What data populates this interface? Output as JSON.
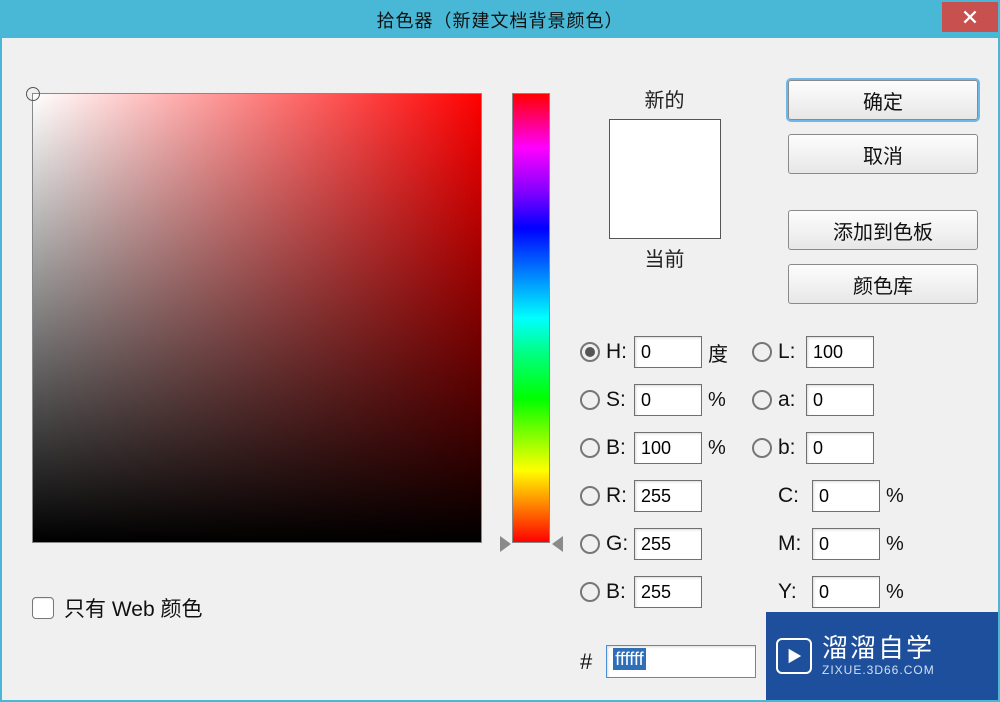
{
  "window": {
    "title": "拾色器（新建文档背景颜色）"
  },
  "swatch": {
    "new_label": "新的",
    "current_label": "当前"
  },
  "buttons": {
    "ok": "确定",
    "cancel": "取消",
    "add_swatch": "添加到色板",
    "color_lib": "颜色库"
  },
  "fields": {
    "h": {
      "label": "H:",
      "value": "0",
      "unit": "度"
    },
    "s": {
      "label": "S:",
      "value": "0",
      "unit": "%"
    },
    "b": {
      "label": "B:",
      "value": "100",
      "unit": "%"
    },
    "r": {
      "label": "R:",
      "value": "255"
    },
    "g": {
      "label": "G:",
      "value": "255"
    },
    "b2": {
      "label": "B:",
      "value": "255"
    },
    "l": {
      "label": "L:",
      "value": "100"
    },
    "a": {
      "label": "a:",
      "value": "0"
    },
    "lb": {
      "label": "b:",
      "value": "0"
    },
    "c": {
      "label": "C:",
      "value": "0",
      "unit": "%"
    },
    "m": {
      "label": "M:",
      "value": "0",
      "unit": "%"
    },
    "y": {
      "label": "Y:",
      "value": "0",
      "unit": "%"
    }
  },
  "hex": {
    "label": "#",
    "value": "ffffff"
  },
  "web_only": {
    "label": "只有 Web 颜色"
  },
  "watermark": {
    "brand": "溜溜自学",
    "url": "ZIXUE.3D66.COM"
  }
}
